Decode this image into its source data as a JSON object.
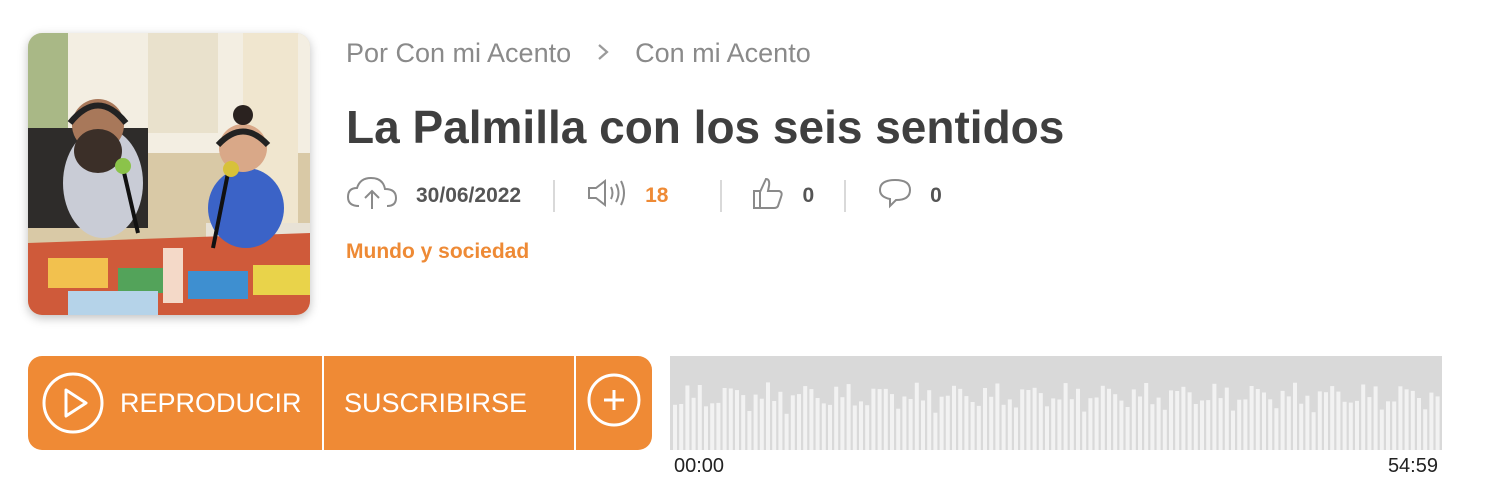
{
  "breadcrumb": {
    "author": "Por Con mi Acento",
    "separator": ">",
    "program": "Con mi Acento"
  },
  "episode": {
    "title": "La Palmilla con los seis sentidos",
    "upload_date": "30/06/2022",
    "plays": "18",
    "likes": "0",
    "comments": "0",
    "category": "Mundo y sociedad",
    "cover_icon": "podcast-cover-image"
  },
  "actions": {
    "play_label": "REPRODUCIR",
    "subscribe_label": "SUSCRIBIRSE",
    "more_icon": "plus-circle-icon"
  },
  "player": {
    "current_time": "00:00",
    "duration": "54:59",
    "progress": 0
  },
  "colors": {
    "accent": "#ee8a35",
    "title": "#3f3f3f",
    "muted": "#888888",
    "waveform_bg": "#d9d9d9",
    "waveform_bar": "#f2f2f2"
  }
}
